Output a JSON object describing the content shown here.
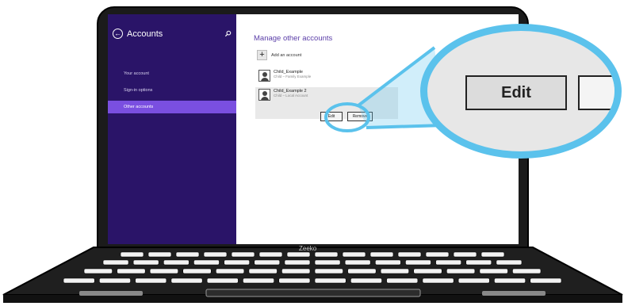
{
  "sidebar": {
    "title": "Accounts",
    "items": [
      {
        "label": "Your account",
        "active": false
      },
      {
        "label": "Sign-in options",
        "active": false
      },
      {
        "label": "Other accounts",
        "active": true
      }
    ]
  },
  "main": {
    "title": "Manage other accounts",
    "add_label": "Add an account",
    "accounts": [
      {
        "name": "Child_Example",
        "sub": "Child – Family Example"
      },
      {
        "name": "Child_Example 2",
        "sub": "Child – Local Account"
      }
    ],
    "edit_label": "Edit",
    "remove_label": "Remove"
  },
  "magnifier": {
    "edit_label": "Edit"
  },
  "brand": "Zeeko",
  "colors": {
    "sidebar_bg": "#2a1468",
    "sidebar_active": "#7a4fe0",
    "magnifier_ring": "#5bc2ec",
    "title_accent": "#5b3ea8"
  }
}
